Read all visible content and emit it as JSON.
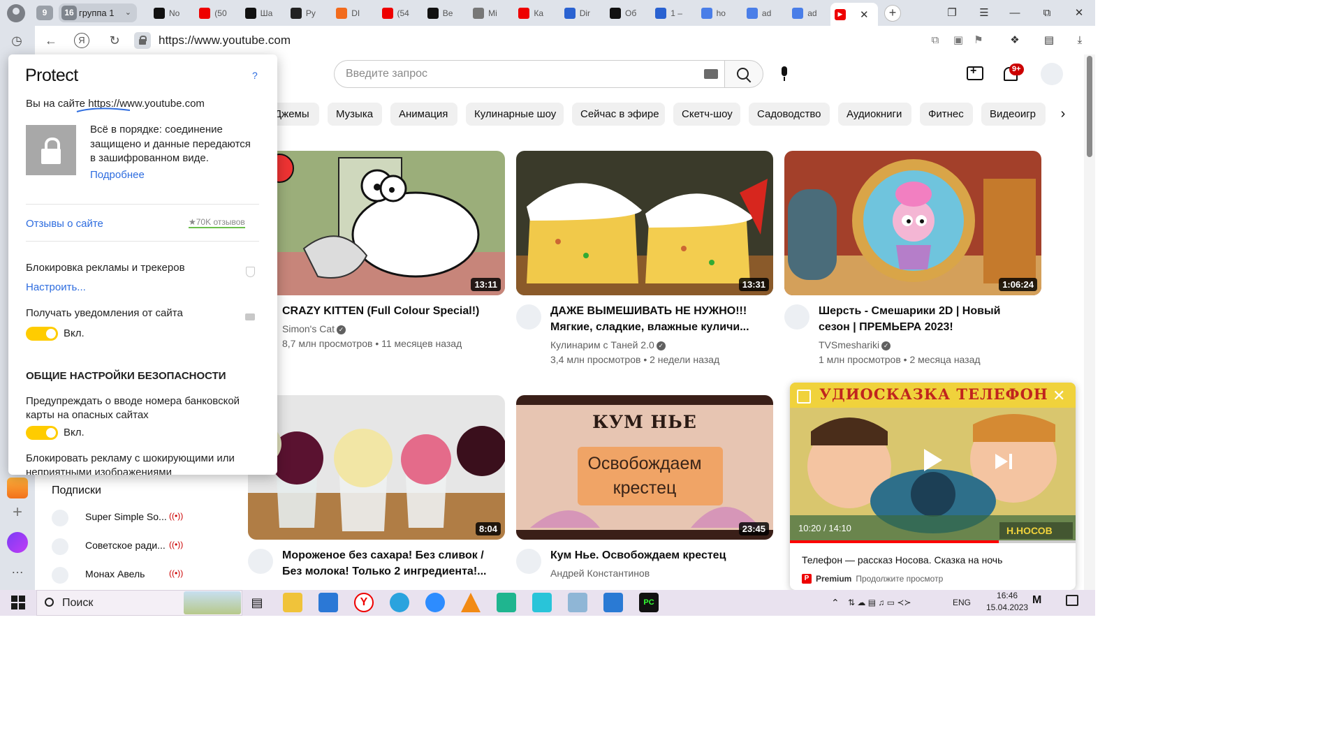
{
  "browser": {
    "group_count": "9",
    "group_badge": "16",
    "group_name": "группа 1",
    "tabs": [
      {
        "icon": "notion-icon",
        "label": "No",
        "bg": "#111"
      },
      {
        "icon": "youtube-icon",
        "label": "(50",
        "bg": "#e00"
      },
      {
        "icon": "chatgpt-icon",
        "label": "Ша",
        "bg": "#111"
      },
      {
        "icon": "github-icon",
        "label": "Py",
        "bg": "#222"
      },
      {
        "icon": "brave-icon",
        "label": "DI",
        "bg": "#f26b1d"
      },
      {
        "icon": "youtube-icon",
        "label": "(54",
        "bg": "#e00"
      },
      {
        "icon": "openai-icon",
        "label": "Be",
        "bg": "#111"
      },
      {
        "icon": "document-icon",
        "label": "Mi",
        "bg": "#777"
      },
      {
        "icon": "youtube-icon",
        "label": "Ка",
        "bg": "#e00"
      },
      {
        "icon": "globe-icon",
        "label": "Dir",
        "bg": "#2a62d1"
      },
      {
        "icon": "openai-icon",
        "label": "Об",
        "bg": "#111"
      },
      {
        "icon": "globe-icon",
        "label": "1 –",
        "bg": "#2a62d1"
      },
      {
        "icon": "doc-blue-icon",
        "label": "ho",
        "bg": "#4a7ee8"
      },
      {
        "icon": "doc-blue-icon",
        "label": "ad",
        "bg": "#4a7ee8"
      },
      {
        "icon": "doc-blue-icon",
        "label": "ad",
        "bg": "#4a7ee8"
      }
    ],
    "active_tab_icon": "youtube-icon",
    "url": "https://www.youtube.com",
    "new_tab": "+"
  },
  "youtube": {
    "search_placeholder": "Введите запрос",
    "notif_badge": "9+",
    "chips": [
      "Джемы",
      "Музыка",
      "Анимация",
      "Кулинарные шоу",
      "Сейчас в эфире",
      "Скетч-шоу",
      "Садоводство",
      "Аудиокниги",
      "Фитнес",
      "Видеоигр"
    ],
    "videos": [
      {
        "title1": "CRAZY KITTEN (Full Colour Special!)",
        "title2": "",
        "channel": "Simon's Cat",
        "meta": "8,7 млн просмотров • 11 месяцев назад",
        "duration": "13:11"
      },
      {
        "title1": "ДАЖЕ ВЫМЕШИВАТЬ НЕ НУЖНО!!!",
        "title2": "Мягкие, сладкие, влажные куличи...",
        "channel": "Кулинарим с Таней 2.0",
        "meta": "3,4 млн просмотров • 2 недели назад",
        "duration": "13:31"
      },
      {
        "title1": "Шерсть - Смешарики 2D | Новый",
        "title2": "сезон | ПРЕМЬЕРА 2023!",
        "channel": "TVSmeshariki",
        "meta": "1 млн просмотров • 2 месяца назад",
        "duration": "1:06:24"
      },
      {
        "title1": "Мороженое без сахара! Без сливок /",
        "title2": "Без молока! Только 2 ингредиента!...",
        "channel": "",
        "meta": "",
        "duration": "8:04"
      },
      {
        "title1": "Кум Нье. Освобождаем крестец",
        "title2": "",
        "channel": "Андрей Константинов",
        "meta": "",
        "duration": "23:45"
      }
    ],
    "thumb_text": {
      "kum_top": "КУМ НЬЕ",
      "kum_line1": "Освобождаем",
      "kum_line2": "крестец"
    },
    "subscriptions_title": "Подписки",
    "subscriptions": [
      "Super Simple So...",
      "Советское ради...",
      "Монах Авель"
    ],
    "mini_player": {
      "banner": "УДИОСКАЗКА ТЕЛЕФОН",
      "corner_text": "Н.НОСОВ",
      "time": "10:20 / 14:10",
      "progress": 0.73,
      "title": "Телефон — рассказ Носова. Сказка на ночь",
      "premium": "Premium",
      "premium_text": "Продолжите просмотр"
    }
  },
  "protect": {
    "title": "Protect",
    "help": "?",
    "site_prefix": "Вы на сайте",
    "site_url": "https://www.youtube.com",
    "status_line1": "Всё в порядке: соединение",
    "status_line2": "защищено и данные передаются",
    "status_line3": "в зашифрованном виде.",
    "more_link": "Подробнее",
    "reviews_link": "Отзывы о сайте",
    "reviews_count": "★70K отзывов",
    "adblock_label": "Блокировка рекламы и трекеров",
    "configure_link": "Настроить...",
    "notify_label": "Получать уведомления от сайта",
    "notify_state": "Вкл.",
    "general_heading": "ОБЩИЕ НАСТРОЙКИ БЕЗОПАСНОСТИ",
    "card_warn_line1": "Предупреждать о вводе номера банковской",
    "card_warn_line2": "карты на опасных сайтах",
    "card_warn_state": "Вкл.",
    "shock_line1": "Блокировать рекламу с шокирующими или",
    "shock_line2": "неприятными изображениями"
  },
  "taskbar": {
    "search_label": "Поиск",
    "lang": "ENG",
    "time": "16:46",
    "date": "15.04.2023"
  }
}
